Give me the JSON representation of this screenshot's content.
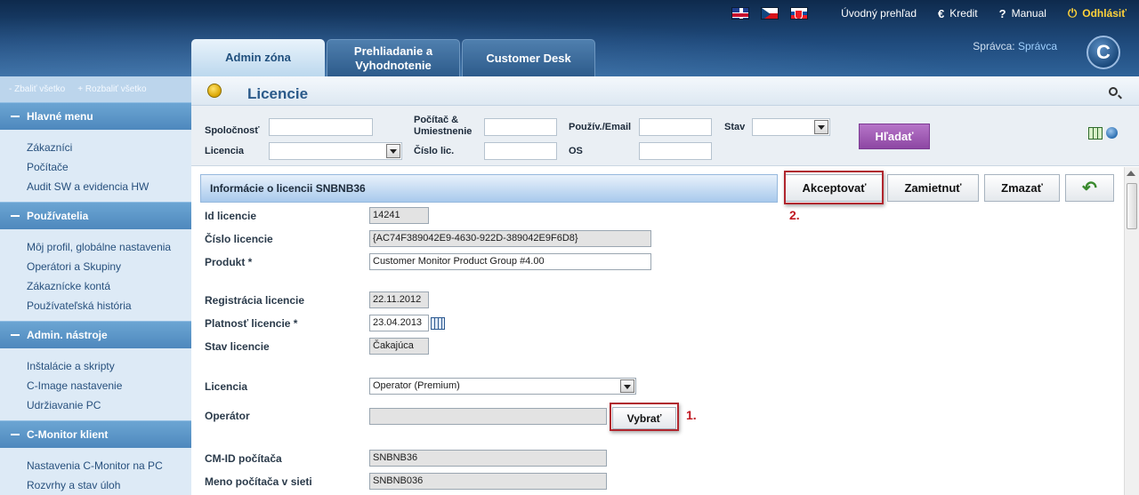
{
  "header": {
    "flags": [
      "flag-uk-icon",
      "flag-cz-icon",
      "flag-sk-icon"
    ],
    "links": {
      "overview": "Úvodný prehľad",
      "credit": "Kredit",
      "credit_icon": "€",
      "manual": "Manual",
      "manual_icon": "?",
      "logout": "Odhlásiť",
      "logout_icon": "⏻"
    },
    "tabs": [
      {
        "label": "Admin zóna",
        "active": true
      },
      {
        "label": "Prehliadanie a Vyhodnotenie",
        "active": false
      },
      {
        "label": "Customer Desk",
        "active": false
      }
    ],
    "user_label": "Správca:",
    "user_name": "Správca",
    "logo_letter": "C",
    "accent_color": "#1f4a7c"
  },
  "sidebar": {
    "collapse_all": "- Zbaliť všetko",
    "expand_all": "+ Rozbaliť všetko",
    "sections": [
      {
        "title": "Hlavné menu",
        "items": [
          "Zákazníci",
          "Počítače",
          "Audit SW a evidencia HW"
        ]
      },
      {
        "title": "Používatelia",
        "items": [
          "Môj profil, globálne nastavenia",
          "Operátori a Skupiny",
          "Zákaznícke kontá",
          "Používateľská história"
        ]
      },
      {
        "title": "Admin. nástroje",
        "items": [
          "Inštalácie a skripty",
          "C-Image nastavenie",
          "Udržiavanie PC"
        ]
      },
      {
        "title": "C-Monitor klient",
        "items": [
          "Nastavenia C-Monitor na PC",
          "Rozvrhy a stav úloh"
        ]
      }
    ]
  },
  "page": {
    "title": "Licencie"
  },
  "filters": {
    "company": "Spoločnosť",
    "computer": "Počítač & Umiestnenie",
    "user_email": "Použív./Email",
    "state": "Stav",
    "license": "Licencia",
    "license_no": "Číslo lic.",
    "os": "OS",
    "search_button": "Hľadať",
    "search_button_color": "#8d47a3"
  },
  "detail": {
    "section_title": "Informácie o licencii SNBNB36",
    "buttons": {
      "accept": "Akceptovať",
      "reject": "Zamietnuť",
      "delete": "Zmazať",
      "back_icon": "↶"
    },
    "fields": {
      "id_label": "Id licencie",
      "id_value": "14241",
      "number_label": "Číslo licencie",
      "number_value": "{AC74F389042E9-4630-922D-389042E9F6D8}",
      "product_label": "Produkt *",
      "product_value": "Customer Monitor Product Group #4.00",
      "registration_label": "Registrácia licencie",
      "registration_value": "22.11.2012",
      "validity_label": "Platnosť licencie *",
      "validity_value": "23.04.2013",
      "state_label": "Stav licencie",
      "state_value": "Čakajúca",
      "license_label": "Licencia",
      "license_value": "Operator (Premium)",
      "operator_label": "Operátor",
      "operator_value": "",
      "choose_button": "Vybrať",
      "cmid_label": "CM-ID počítača",
      "cmid_value": "SNBNB36",
      "netname_label": "Meno počítača v sieti",
      "netname_value": "SNBNB036"
    },
    "annotations": {
      "step1": "1.",
      "step2": "2.",
      "color": "#c0161f"
    }
  }
}
